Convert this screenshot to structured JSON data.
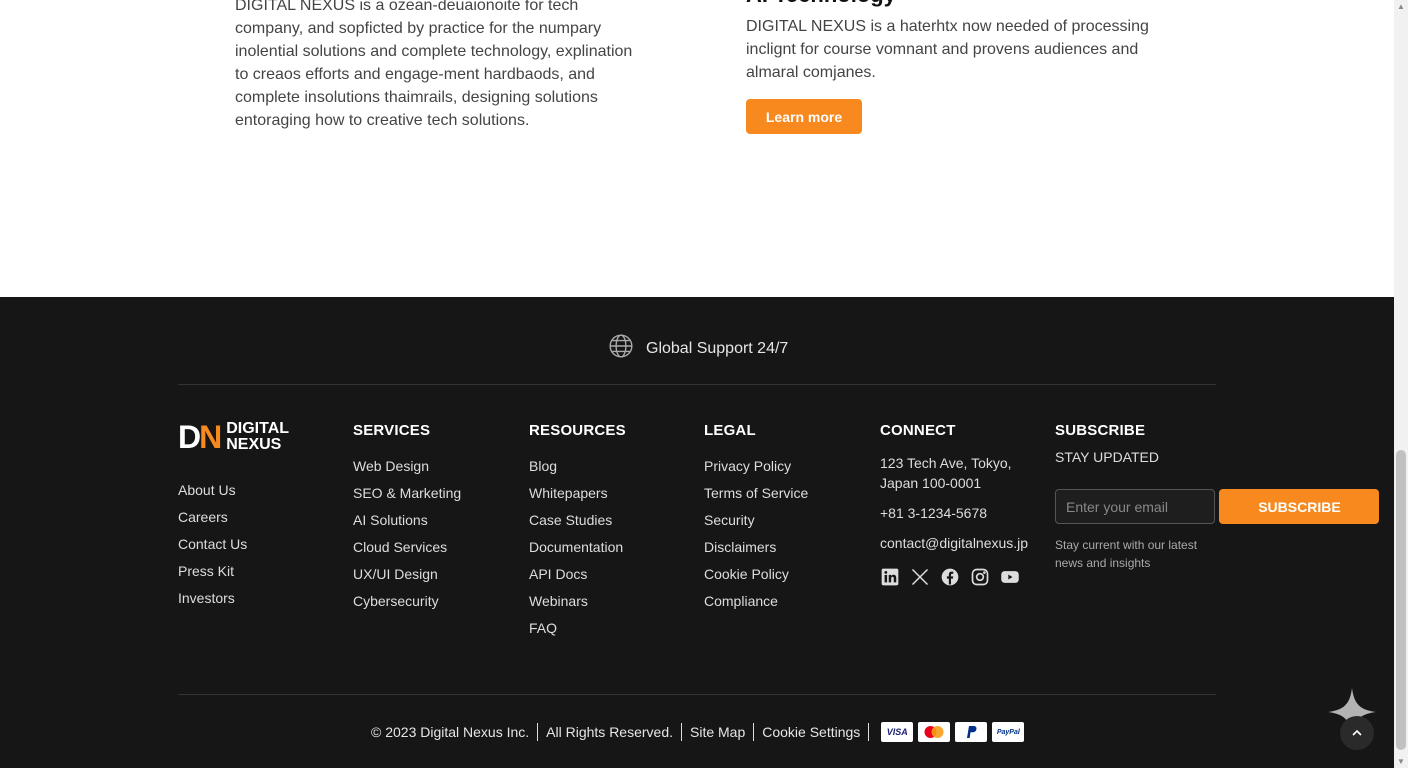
{
  "top": {
    "left_text": "DIGITAL NEXUS is a ozean-deuaionoite for tech company, and sopficted by practice for the numpary inolential solutions and complete technology, explination to creaos efforts and engage-ment hardbaods, and complete insolutions thaimrails, designing solutions entoraging how to creative tech solutions.",
    "right_heading": "AI Technology",
    "right_text": "DIGITAL NEXUS is a haterhtx now needed of processing inclignt for course vomnant and provens audiences and almaral comjanes.",
    "learn_more": "Learn more"
  },
  "footer": {
    "support": "Global Support 24/7",
    "logo": {
      "mark_d": "D",
      "mark_n": "N",
      "line1": "DIGITAL",
      "line2": "NEXUS"
    },
    "about": [
      "About Us",
      "Careers",
      "Contact Us",
      "Press Kit",
      "Investors"
    ],
    "services": {
      "title": "SERVICES",
      "items": [
        "Web Design",
        "SEO & Marketing",
        "AI Solutions",
        "Cloud Services",
        "UX/UI Design",
        "Cybersecurity"
      ]
    },
    "resources": {
      "title": "RESOURCES",
      "items": [
        "Blog",
        "Whitepapers",
        "Case Studies",
        "Documentation",
        "API Docs",
        "Webinars",
        "FAQ"
      ]
    },
    "legal": {
      "title": "LEGAL",
      "items": [
        "Privacy Policy",
        "Terms of Service",
        "Security",
        "Disclaimers",
        "Cookie Policy",
        "Compliance"
      ]
    },
    "connect": {
      "title": "CONNECT",
      "address": "123 Tech Ave, Tokyo, Japan 100-0001",
      "phone": "+81 3-1234-5678",
      "email": "contact@digitalnexus.jp",
      "socials": [
        "linkedin-icon",
        "x-icon",
        "facebook-icon",
        "instagram-icon",
        "youtube-icon"
      ]
    },
    "subscribe": {
      "title": "SUBSCRIBE",
      "label": "STAY UPDATED",
      "placeholder": "Enter your email",
      "button": "SUBSCRIBE",
      "note": "Stay current with our latest news and insights"
    },
    "bottom": {
      "copyright": "© 2023 Digital Nexus Inc.",
      "rights": "All Rights Reserved.",
      "sitemap": "Site Map",
      "cookie": "Cookie Settings",
      "payments": [
        "VISA",
        "PayPal"
      ]
    }
  },
  "colors": {
    "accent": "#f7891e",
    "footer_bg": "#161616"
  }
}
